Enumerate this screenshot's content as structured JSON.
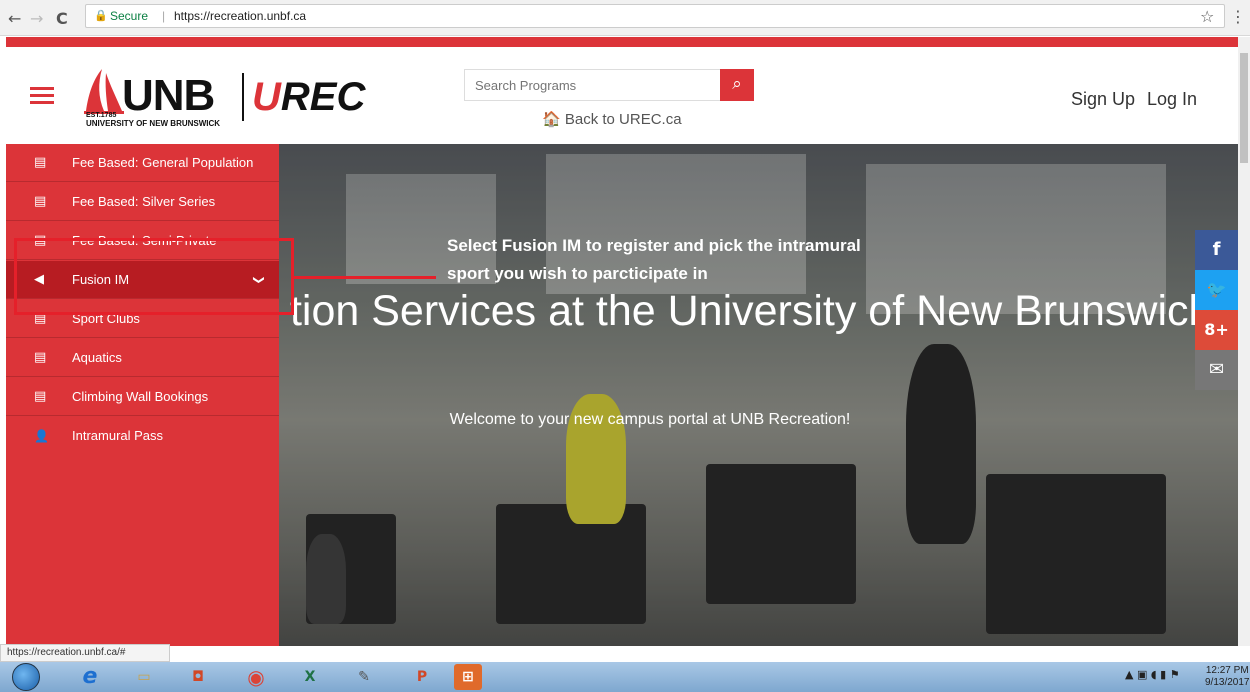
{
  "browser": {
    "back": "←",
    "forward": "→",
    "reload": "C",
    "lock": "🔒",
    "secure_label": "Secure",
    "separator": "|",
    "url": "https://recreation.unbf.ca",
    "star": "☆",
    "menu": "⋮"
  },
  "header": {
    "logo": {
      "unb": "UNB",
      "est": "EST.1785",
      "university_name": "UNIVERSITY OF NEW BRUNSWICK",
      "urec": "REC",
      "urec_u": "U"
    },
    "search": {
      "placeholder": "Search Programs",
      "button_icon": "search-icon"
    },
    "back_link": "🏠 Back to UREC.ca",
    "sign_up": "Sign Up",
    "log_in": "Log In"
  },
  "sidebar": {
    "items": [
      {
        "label": "Fee Based: General Population",
        "icon": "list-icon",
        "glyph": "▤"
      },
      {
        "label": "Fee Based: Silver Series",
        "icon": "list-icon",
        "glyph": "▤"
      },
      {
        "label": "Fee Based: Semi-Private",
        "icon": "list-icon",
        "glyph": "▤"
      },
      {
        "label": "Fusion IM",
        "icon": "megaphone-icon",
        "glyph": "◀",
        "active": true,
        "chevron": "❯"
      },
      {
        "label": "Sport Clubs",
        "icon": "list-icon",
        "glyph": "▤"
      },
      {
        "label": "Aquatics",
        "icon": "list-icon",
        "glyph": "▤"
      },
      {
        "label": "Climbing Wall Bookings",
        "icon": "list-icon",
        "glyph": "▤"
      },
      {
        "label": "Intramural Pass",
        "icon": "user-icon",
        "glyph": "👤"
      }
    ]
  },
  "hero": {
    "title": "tion Services at the University of New Brunswick",
    "subtitle": "Welcome to your new campus portal at UNB Recreation!"
  },
  "annotation": {
    "text": "Select Fusion IM to register and pick the intramural sport you wish to parcticipate in"
  },
  "social": [
    {
      "name": "facebook",
      "glyph": "f",
      "color": "#3b5998"
    },
    {
      "name": "twitter",
      "glyph": "🐦",
      "color": "#1da1f2"
    },
    {
      "name": "google-plus",
      "glyph": "8+",
      "color": "#dd4b39"
    },
    {
      "name": "email",
      "glyph": "✉",
      "color": "#777777"
    }
  ],
  "status_url": "https://recreation.unbf.ca/#",
  "taskbar": {
    "time": "12:27 PM",
    "date": "9/13/2017"
  },
  "colors": {
    "brand_red": "#dc3439",
    "active_red": "#b71c22",
    "annotation_red": "#e5202a"
  }
}
